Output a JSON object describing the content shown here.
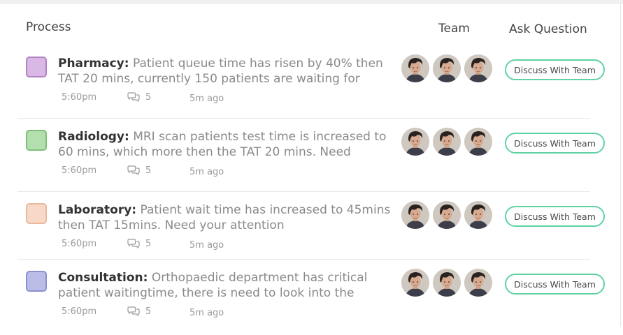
{
  "headers": {
    "process": "Process",
    "team": "Team",
    "ask_question": "Ask Question"
  },
  "rows": [
    {
      "department": "Pharmacy:",
      "message": " Patient queue time has risen by 40% then TAT 20 mins, currently 150 patients are waiting for",
      "time": "5:60pm",
      "comments": "5",
      "ago": "5m ago",
      "color": "#d9b8e6",
      "border_color": "#b184c4",
      "button_label": "Discuss With Team"
    },
    {
      "department": "Radiology:",
      "message": " MRI scan patients test time is increased to 60 mins, which more then the TAT 20 mins. Need",
      "time": "5:60pm",
      "comments": "5",
      "ago": "5m ago",
      "color": "#b3dfae",
      "border_color": "#7fbf78",
      "button_label": "Discuss With Team"
    },
    {
      "department": "Laboratory:",
      "message": " Patient wait time has increased to 45mins then TAT 15mins. Need your attention",
      "time": "5:60pm",
      "comments": "5",
      "ago": "5m ago",
      "color": "#f8d8c6",
      "border_color": "#eab99e",
      "button_label": "Discuss With Team"
    },
    {
      "department": "Consultation:",
      "message": " Orthopaedic department has critical patient waitingtime, there is need to look into the",
      "time": "5:60pm",
      "comments": "5",
      "ago": "5m ago",
      "color": "#b9bde8",
      "border_color": "#8d92cf",
      "button_label": "Discuss With Team"
    }
  ],
  "icons": {
    "comments": "comments-icon",
    "avatar": "team-member-avatar"
  },
  "colors": {
    "button_border": "#5fd3a3",
    "muted_text": "#8a8a8a"
  }
}
